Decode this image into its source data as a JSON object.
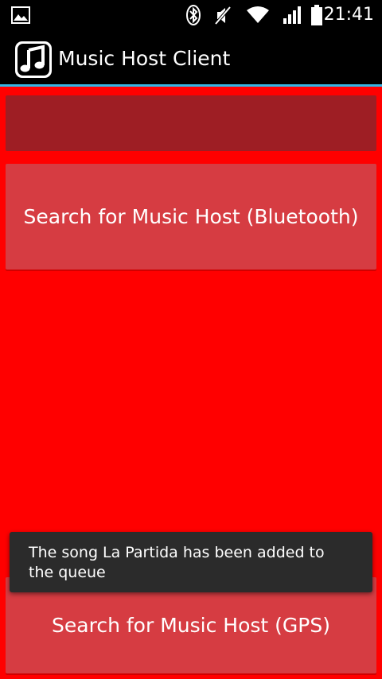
{
  "status_bar": {
    "time": "21:41",
    "icons": [
      "image-icon",
      "bluetooth-icon",
      "mute-icon",
      "wifi-icon",
      "signal-icon",
      "battery-icon"
    ]
  },
  "action_bar": {
    "title": "Music Host Client",
    "app_icon": "music-note-icon"
  },
  "main": {
    "bluetooth_button_label": "Search for Music Host (Bluetooth)",
    "gps_button_label": "Search for Music Host (GPS)"
  },
  "toast": {
    "message": "The song La Partida has been added to the queue"
  },
  "colors": {
    "background": "#ff0000",
    "header_box": "#9e1e24",
    "button": "#d63c42",
    "accent_divider": "#33b5e5",
    "toast_bg": "#2b2b2b"
  }
}
